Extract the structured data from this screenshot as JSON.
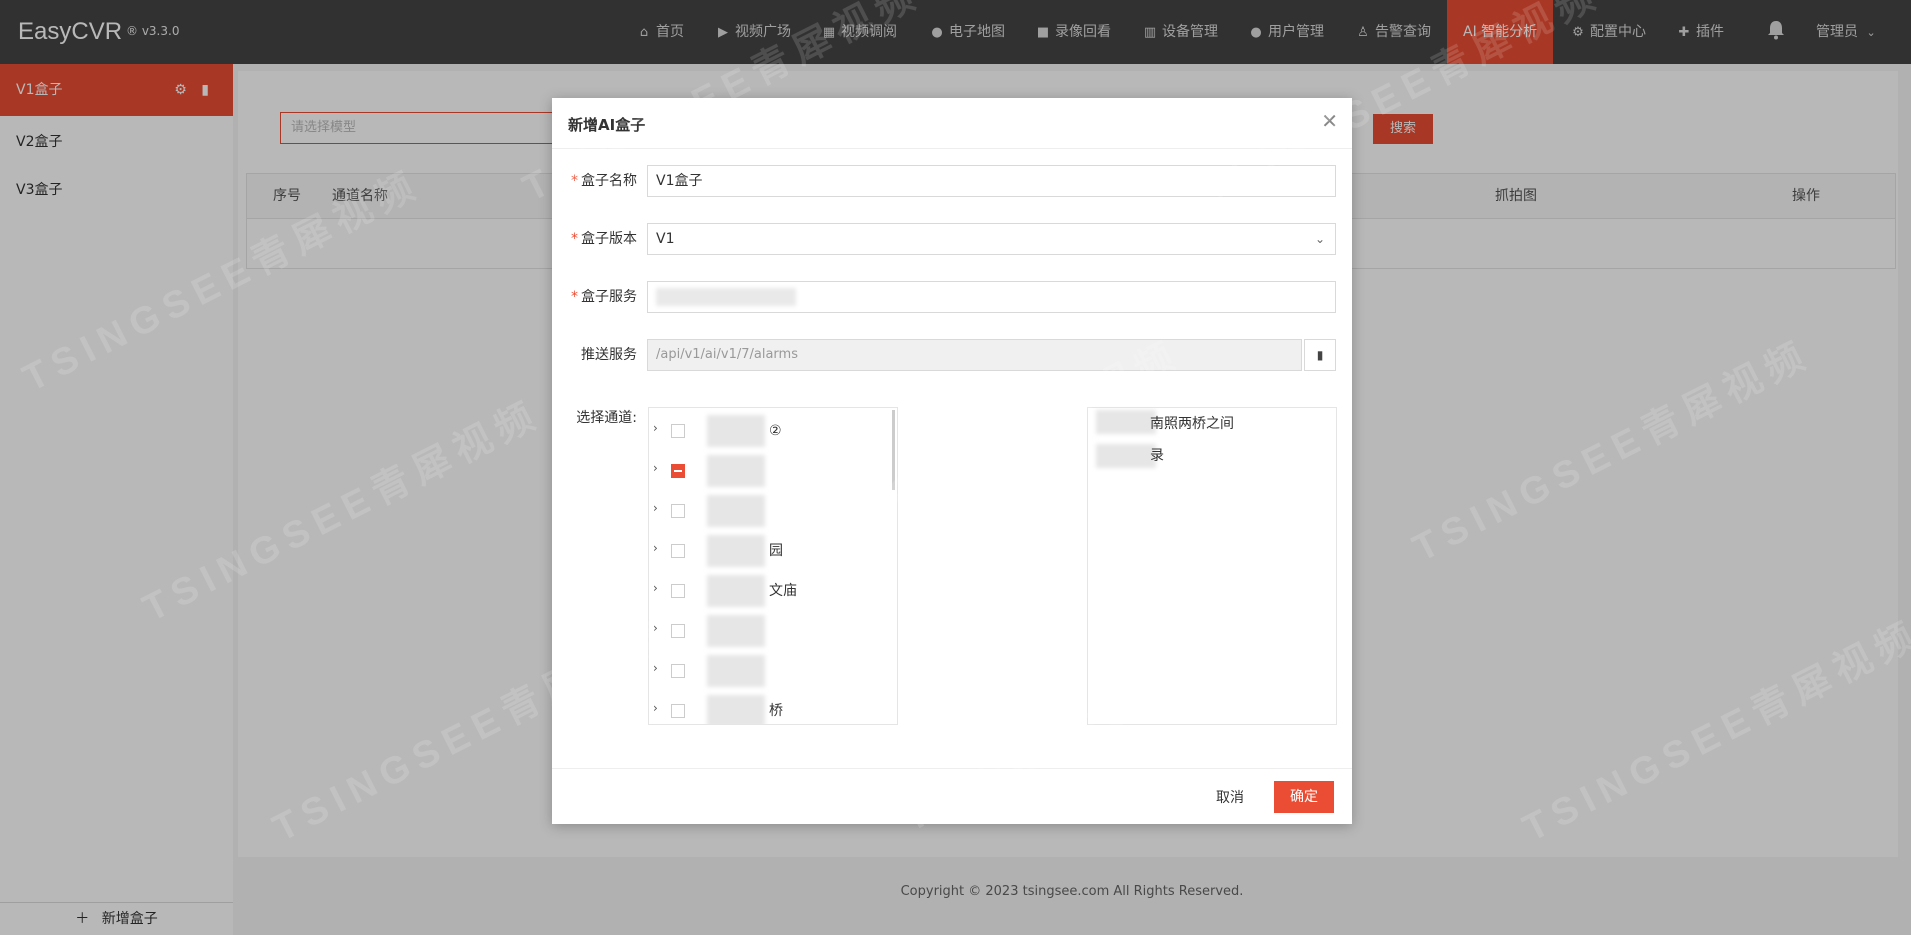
{
  "app": {
    "brand": "EasyCVR",
    "version": "® v3.3.0"
  },
  "nav": {
    "items": [
      {
        "label": "首页",
        "icon": "home-icon"
      },
      {
        "label": "视频广场",
        "icon": "play-circle-icon"
      },
      {
        "label": "视频调阅",
        "icon": "table-icon"
      },
      {
        "label": "电子地图",
        "icon": "map-pin-icon"
      },
      {
        "label": "录像回看",
        "icon": "video-camera-icon"
      },
      {
        "label": "设备管理",
        "icon": "columns-icon"
      },
      {
        "label": "用户管理",
        "icon": "user-gear-icon"
      },
      {
        "label": "告警查询",
        "icon": "alarm-light-icon"
      },
      {
        "label": "AI 智能分析",
        "icon": "",
        "active": true
      },
      {
        "label": "配置中心",
        "icon": "gear-icon"
      },
      {
        "label": "插件",
        "icon": "puzzle-icon"
      }
    ],
    "user": "管理员",
    "accent_color": "#ea4d34"
  },
  "sidebar": {
    "items": [
      {
        "label": "V1盒子",
        "active": true
      },
      {
        "label": "V2盒子"
      },
      {
        "label": "V3盒子"
      }
    ],
    "add_label": "新增盒子"
  },
  "main": {
    "model_placeholder": "请选择模型",
    "search_label": "搜索",
    "table_headers": [
      "序号",
      "通道名称",
      "抓拍图",
      "操作"
    ],
    "footer": "Copyright © 2023 tsingsee.com All Rights Reserved."
  },
  "dialog": {
    "title": "新增AI盒子",
    "fields": {
      "name": {
        "label": "盒子名称",
        "value": "V1盒子",
        "required": true
      },
      "version": {
        "label": "盒子版本",
        "value": "V1",
        "required": true
      },
      "service": {
        "label": "盒子服务",
        "value": "",
        "required": true
      },
      "push": {
        "label": "推送服务",
        "value": "/api/v1/ai/v1/7/alarms",
        "required": false
      }
    },
    "channel_label": "选择通道:",
    "tree": [
      {
        "text": "②",
        "state": "unchecked"
      },
      {
        "text": "",
        "state": "partial"
      },
      {
        "text": "",
        "state": "unchecked"
      },
      {
        "text": "园",
        "state": "unchecked"
      },
      {
        "text": "文庙",
        "state": "unchecked"
      },
      {
        "text": "",
        "state": "unchecked"
      },
      {
        "text": "",
        "state": "unchecked"
      },
      {
        "text": "桥",
        "state": "unchecked"
      }
    ],
    "selected": [
      {
        "text": "南照两桥之间"
      },
      {
        "text": "录"
      }
    ],
    "cancel_label": "取消",
    "ok_label": "确定"
  },
  "watermark": "TSINGSEE青犀视频"
}
